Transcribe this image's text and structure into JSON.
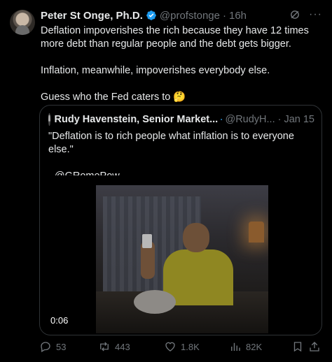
{
  "tweet": {
    "author_name": "Peter St Onge, Ph.D.",
    "handle": "@profstonge",
    "separator": "·",
    "time": "16h",
    "more": "···",
    "paragraphs": [
      "Deflation impoverishes the rich because they have 12 times more debt than regular people and the debt gets bigger.",
      "Inflation, meanwhile, impoverishes everybody else.",
      "Guess who the Fed caters to 🤔"
    ]
  },
  "quote": {
    "author_name": "Rudy Havenstein, Senior Market...",
    "handle": "@RudyH...",
    "separator": "·",
    "date": "Jan 15",
    "paragraphs": [
      "\"Deflation is to rich people what inflation is to everyone else.\"",
      "- @GRomePow"
    ],
    "video_time": "0:06"
  },
  "actions": {
    "replies": "53",
    "reposts": "443",
    "likes": "1.8K",
    "views": "82K"
  },
  "colors": {
    "background": "#000000",
    "text": "#e7e9ea",
    "muted": "#71767b",
    "verified": "#1d9bf0",
    "border": "#2f3336"
  }
}
